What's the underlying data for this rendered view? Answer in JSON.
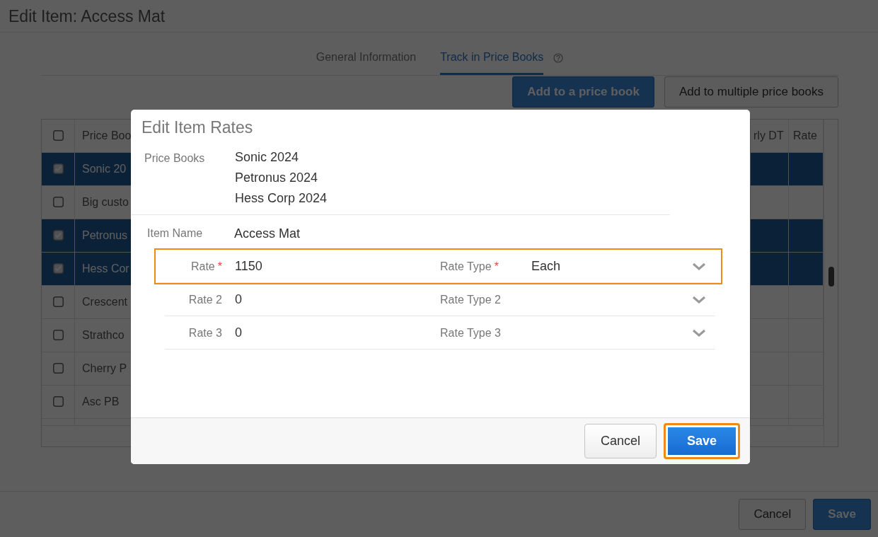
{
  "page": {
    "title": "Edit Item: Access Mat"
  },
  "tabs": [
    {
      "label": "General Information",
      "selected": false,
      "help": false
    },
    {
      "label": "Track in Price Books",
      "selected": true,
      "help": true
    }
  ],
  "toolbar_buttons": [
    {
      "label": "Add to a price book",
      "kind": "primary"
    },
    {
      "label": "Add to multiple price books",
      "kind": "secondary"
    }
  ],
  "table": {
    "header_checked": false,
    "columns": [
      "Price Boo",
      "rly DT",
      "Rate"
    ],
    "rows": [
      {
        "column_1": "Sonic 20",
        "checked": true,
        "selected": true
      },
      {
        "column_1": "Big custo",
        "checked": false,
        "selected": false
      },
      {
        "column_1": "Petronus",
        "checked": true,
        "selected": true
      },
      {
        "column_1": "Hess Cor",
        "checked": true,
        "selected": true
      },
      {
        "column_1": "Crescent",
        "checked": false,
        "selected": false
      },
      {
        "column_1": "Strathco",
        "checked": false,
        "selected": false
      },
      {
        "column_1": "Cherry P",
        "checked": false,
        "selected": false
      },
      {
        "column_1": "Asc PB",
        "checked": false,
        "selected": false
      }
    ]
  },
  "footer_buttons": [
    {
      "label": "Cancel",
      "kind": "secondary"
    },
    {
      "label": "Save",
      "kind": "primary"
    }
  ],
  "dialog": {
    "title": "Edit Item Rates",
    "price_books_label": "Price Books",
    "price_books": [
      "Sonic 2024",
      "Petronus 2024",
      "Hess Corp 2024"
    ],
    "item_name_label": "Item Name",
    "item_name": "Access Mat",
    "rate_rows": [
      {
        "rate_label": "Rate",
        "rate_required_mark": "*",
        "rate": "1150",
        "type_label": "Rate Type",
        "type_required_mark": "*",
        "type": "Each",
        "highlighted": true
      },
      {
        "rate_label": "Rate 2",
        "rate": "0",
        "type_label": "Rate Type 2",
        "highlighted": false
      },
      {
        "rate_label": "Rate 3",
        "rate": "0",
        "type_label": "Rate Type 3",
        "highlighted": false
      }
    ],
    "buttons": [
      {
        "label": "Cancel",
        "kind": "secondary",
        "highlighted": false
      },
      {
        "label": "Save",
        "kind": "primary",
        "highlighted": true
      }
    ]
  }
}
